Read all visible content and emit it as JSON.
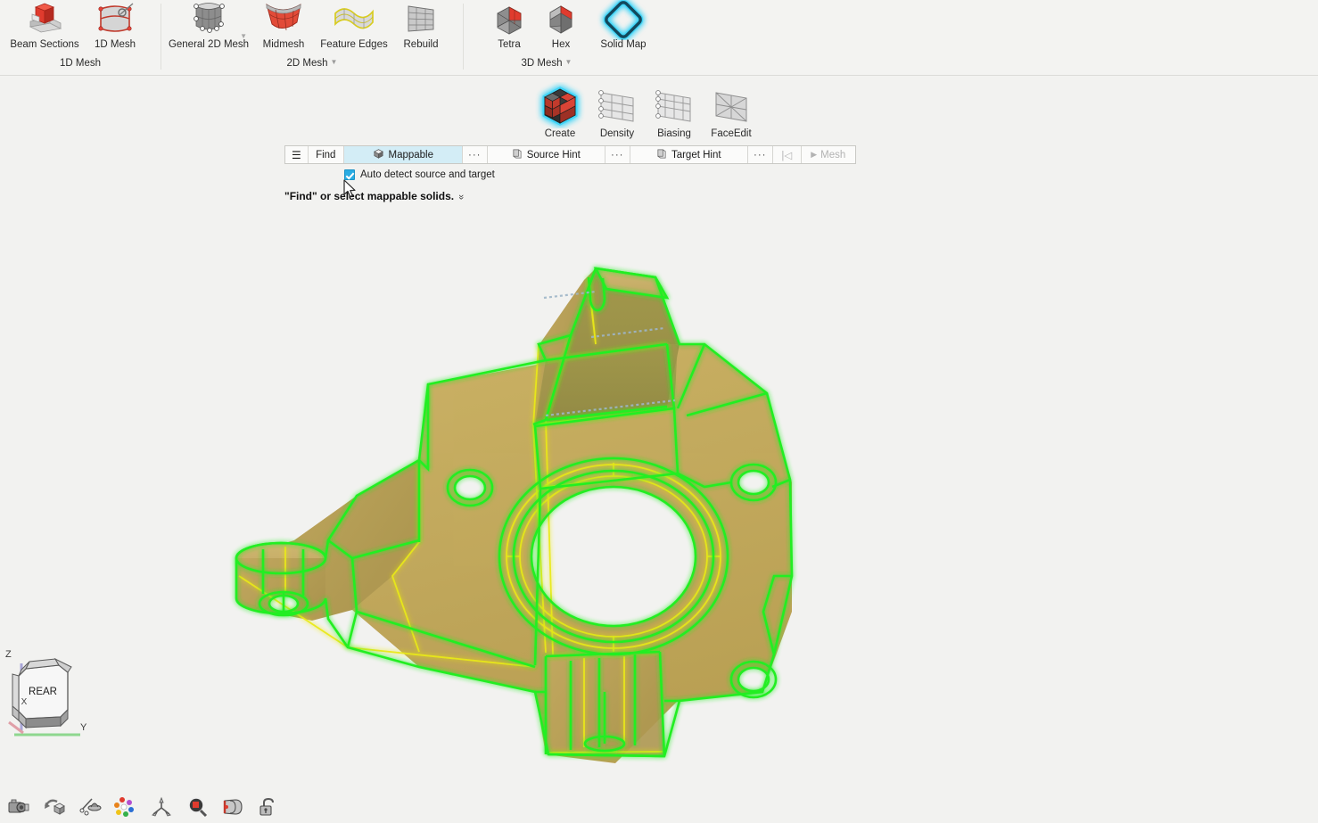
{
  "app": {
    "viewport_background": "#f2f2f0",
    "ribbon_background": "#f3f3f1",
    "accent_highlight": "#d3edf6",
    "glow_color": "#35d2f5",
    "model_surface_color": "#c4a95a",
    "model_edge_green": "#22ee22",
    "model_edge_yellow": "#eaea17",
    "model_section_dots": "#9fb6c8"
  },
  "ribbon": {
    "groups": [
      {
        "title": "1D Mesh",
        "has_dropdown": false,
        "items": [
          {
            "label": "Beam Sections",
            "icon": "beam-section-icon",
            "active": false
          },
          {
            "label": "1D Mesh",
            "icon": "one-d-mesh-icon",
            "active": false
          }
        ]
      },
      {
        "title": "2D Mesh",
        "has_dropdown": true,
        "items": [
          {
            "label": "General 2D Mesh",
            "icon": "general-2d-mesh-icon",
            "active": false,
            "has_dropdown": true
          },
          {
            "label": "Midmesh",
            "icon": "midmesh-icon",
            "active": false
          },
          {
            "label": "Feature Edges",
            "icon": "feature-edges-icon",
            "active": false
          },
          {
            "label": "Rebuild",
            "icon": "rebuild-icon",
            "active": false
          }
        ]
      },
      {
        "title": "3D Mesh",
        "has_dropdown": true,
        "items": [
          {
            "label": "Tetra",
            "icon": "tetra-mesh-icon",
            "active": false
          },
          {
            "label": "Hex",
            "icon": "hex-mesh-icon",
            "active": false
          },
          {
            "label": "Solid Map",
            "icon": "solid-map-icon",
            "active": true
          }
        ]
      }
    ]
  },
  "subtoolbar": {
    "items": [
      {
        "label": "Create",
        "icon": "create-cube-icon",
        "active": true
      },
      {
        "label": "Density",
        "icon": "density-grid-icon",
        "active": false
      },
      {
        "label": "Biasing",
        "icon": "biasing-grid-icon",
        "active": false
      },
      {
        "label": "FaceEdit",
        "icon": "face-edit-icon",
        "active": false
      }
    ]
  },
  "command_bar": {
    "menu_icon": "hamburger-menu-icon",
    "menu_glyph": "☰",
    "find_label": "Find",
    "mappable_label": "Mappable",
    "mappable_icon": "solid-cube-icon",
    "mappable_selected": true,
    "overflow_label": "···",
    "source_hint_label": "Source Hint",
    "source_hint_icon": "source-hint-icon",
    "target_hint_label": "Target Hint",
    "target_hint_icon": "target-hint-icon",
    "step_back_glyph": "|◁",
    "step_back_icon": "step-back-icon",
    "mesh_label": "Mesh",
    "mesh_play_glyph": "▶",
    "mesh_enabled": false
  },
  "options": {
    "auto_detect_label": "Auto detect source and target",
    "auto_detect_checked": true
  },
  "status": {
    "text": "\"Find\" or select mappable solids.",
    "expand_glyph": "»"
  },
  "view_cube": {
    "face_label": "REAR",
    "axis_z": "Z",
    "axis_y": "Y",
    "axis_x": "X"
  },
  "bottom_bar": {
    "items": [
      {
        "icon": "visualization-camera-icon",
        "label": "Visualization"
      },
      {
        "icon": "rotate-view-icon",
        "label": "Rotate View"
      },
      {
        "icon": "point-pick-icon",
        "label": "Pick Point"
      },
      {
        "icon": "color-palette-icon",
        "label": "Color Palette"
      },
      {
        "icon": "axis-triad-icon",
        "label": "Axis Triad"
      },
      {
        "icon": "zoom-magnifier-icon",
        "label": "Zoom"
      },
      {
        "icon": "two-d-three-d-view-icon",
        "label": "2D/3D View"
      },
      {
        "icon": "lock-icon",
        "label": "Lock"
      }
    ]
  },
  "model": {
    "name": "steering-knuckle-solid",
    "selected": true,
    "selection_color": "#22ee22"
  }
}
